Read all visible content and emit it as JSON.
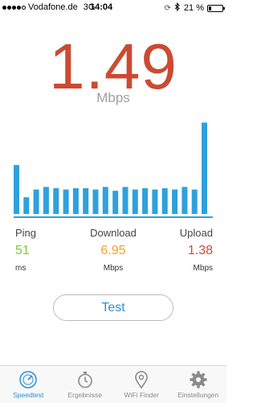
{
  "status_bar": {
    "carrier": "Vodafone.de",
    "network": "3G",
    "time": "14:04",
    "battery_percent": "21 %",
    "battery_level": 0.21,
    "icons": [
      "signal-dots-icon",
      "sync-icon",
      "bluetooth-icon",
      "battery-icon"
    ]
  },
  "speed": {
    "value": "1.49",
    "unit": "Mbps"
  },
  "chart_data": {
    "type": "bar",
    "values": [
      0.38,
      0.13,
      0.19,
      0.21,
      0.2,
      0.19,
      0.2,
      0.2,
      0.19,
      0.21,
      0.18,
      0.21,
      0.19,
      0.2,
      0.19,
      0.2,
      0.19,
      0.21,
      0.19,
      0.71
    ],
    "bar_color": "#2ea1dd"
  },
  "metrics": {
    "ping": {
      "label": "Ping",
      "value": "51",
      "unit": "ms"
    },
    "download": {
      "label": "Download",
      "value": "6.95",
      "unit": "Mbps"
    },
    "upload": {
      "label": "Upload",
      "value": "1.38",
      "unit": "Mbps"
    }
  },
  "test_button": {
    "label": "Test"
  },
  "tabs": [
    {
      "label": "Speedtest",
      "icon": "speedometer-icon",
      "active": true
    },
    {
      "label": "Ergebnisse",
      "icon": "stopwatch-icon",
      "active": false
    },
    {
      "label": "WiFi Finder",
      "icon": "location-pin-icon",
      "active": false
    },
    {
      "label": "Einstellungen",
      "icon": "gear-icon",
      "active": false
    }
  ],
  "colors": {
    "speed": "#cc4a32",
    "ping": "#7ac943",
    "download": "#f0a232",
    "upload": "#cc4a32",
    "accent": "#2e8fd6"
  }
}
